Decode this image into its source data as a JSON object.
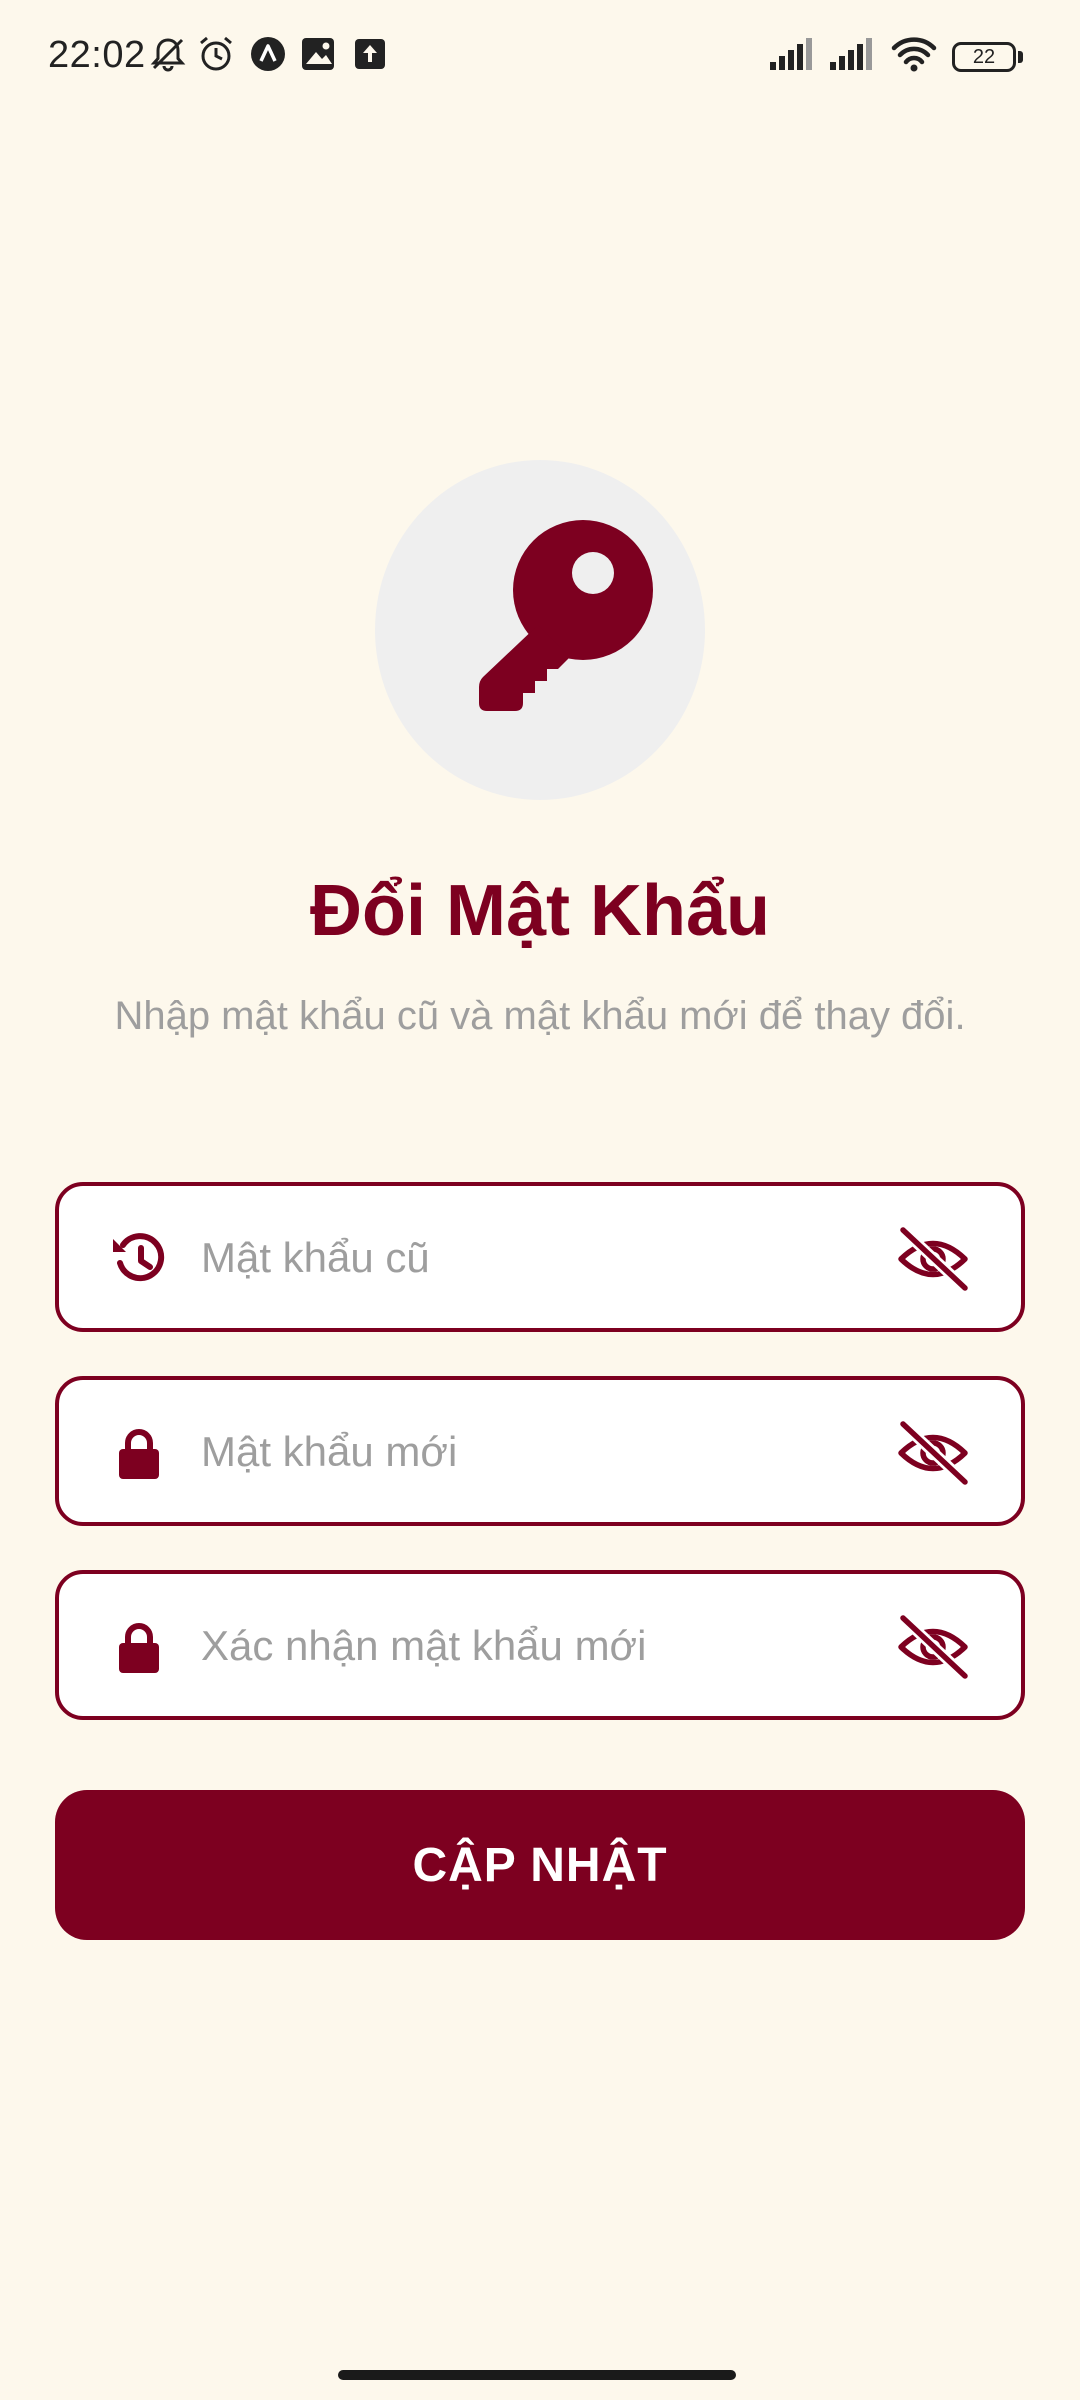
{
  "status_bar": {
    "time": "22:02",
    "battery_level": "22",
    "icons": [
      "bell-off-icon",
      "alarm-icon",
      "app-a-icon",
      "app-photo-icon",
      "upload-icon",
      "signal-1-icon",
      "signal-2-icon",
      "wifi-icon",
      "battery-icon"
    ]
  },
  "hero": {
    "icon": "key-icon",
    "circle_color": "#efefef"
  },
  "page": {
    "title": "Đổi Mật Khẩu",
    "subtitle": "Nhập mật khẩu cũ và mật khẩu mới để thay đổi."
  },
  "form": {
    "old_password": {
      "placeholder": "Mật khẩu cũ",
      "value": "",
      "icon": "history-icon"
    },
    "new_password": {
      "placeholder": "Mật khẩu mới",
      "value": "",
      "icon": "lock-icon"
    },
    "confirm_password": {
      "placeholder": "Xác nhận mật khẩu mới",
      "value": "",
      "icon": "lock-icon"
    },
    "visibility_toggle_icon": "eye-off-icon",
    "submit_label": "CẬP NHẬT"
  },
  "colors": {
    "accent": "#7d0020",
    "background": "#fdf8ec",
    "muted_text": "#9e9e9e"
  }
}
